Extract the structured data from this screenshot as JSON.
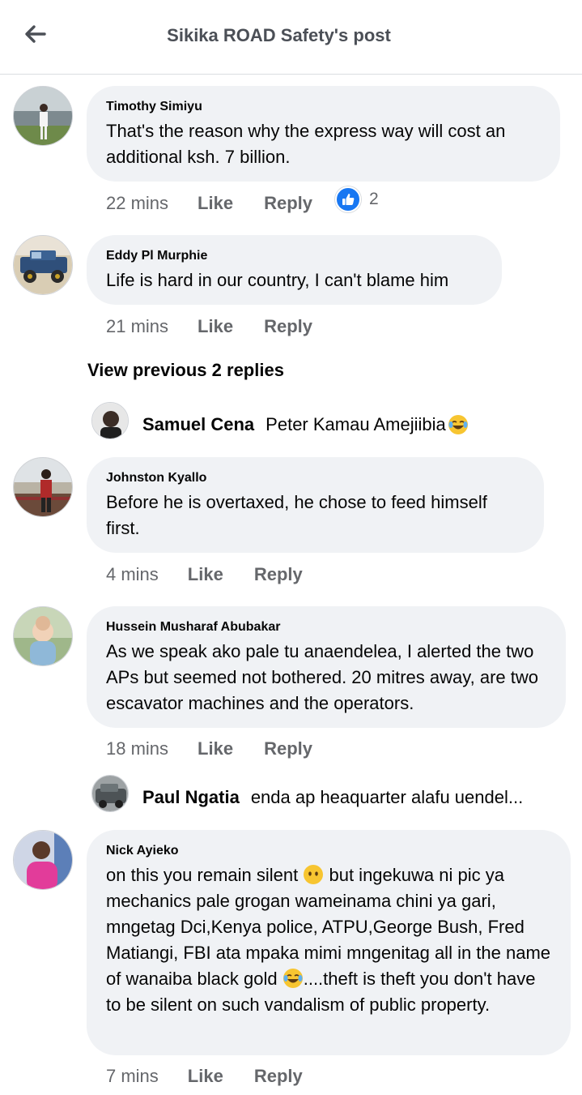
{
  "header": {
    "title": "Sikika ROAD Safety's post"
  },
  "comments": [
    {
      "author": "Timothy Simiyu",
      "text": "That's the reason why the express way will cost an additional ksh.  7 billion.",
      "time": "22 mins",
      "like_label": "Like",
      "reply_label": "Reply",
      "reactions": "2"
    },
    {
      "author": "Eddy Pl Murphie",
      "text": "Life is hard in our country, I can't blame him",
      "time": "21 mins",
      "like_label": "Like",
      "reply_label": "Reply"
    },
    {
      "author": "Johnston Kyallo",
      "text": "Before he is overtaxed, he chose to feed himself first.",
      "time": "4 mins",
      "like_label": "Like",
      "reply_label": "Reply"
    },
    {
      "author": "Hussein Musharaf Abubakar",
      "text": "As we speak ako pale tu anaendelea, I alerted the two APs but seemed not bothered. 20 mitres away, are two escavator machines and the operators.",
      "time": "18 mins",
      "like_label": "Like",
      "reply_label": "Reply"
    },
    {
      "author": "Nick Ayieko",
      "text_1": "on this you remain silent",
      "text_2": "but ingekuwa ni pic ya mechanics pale grogan wameinama chini ya gari, mngetag Dci,Kenya police, ATPU,George Bush, Fred Matiangi, FBI ata mpaka mimi mngenitag all in the name of wanaiba black gold",
      "text_3": "....theft is theft you don't have to be silent on such vandalism of public property.",
      "time": "7 mins",
      "like_label": "Like",
      "reply_label": "Reply"
    }
  ],
  "view_previous": "View previous 2 replies",
  "replies": [
    {
      "author": "Samuel Cena",
      "text": "Peter Kamau Amejiibia"
    },
    {
      "author": "Paul Ngatia",
      "text": "enda ap heaquarter alafu uendel..."
    }
  ],
  "icons": {
    "back": "arrow-left-icon",
    "like_reaction": "thumbs-up-icon",
    "laugh": "tears-of-joy-emoji",
    "neutral": "no-mouth-face-emoji"
  },
  "colors": {
    "bubble": "#f0f2f5",
    "like_blue": "#1877f2",
    "secondary_text": "#65676b"
  }
}
